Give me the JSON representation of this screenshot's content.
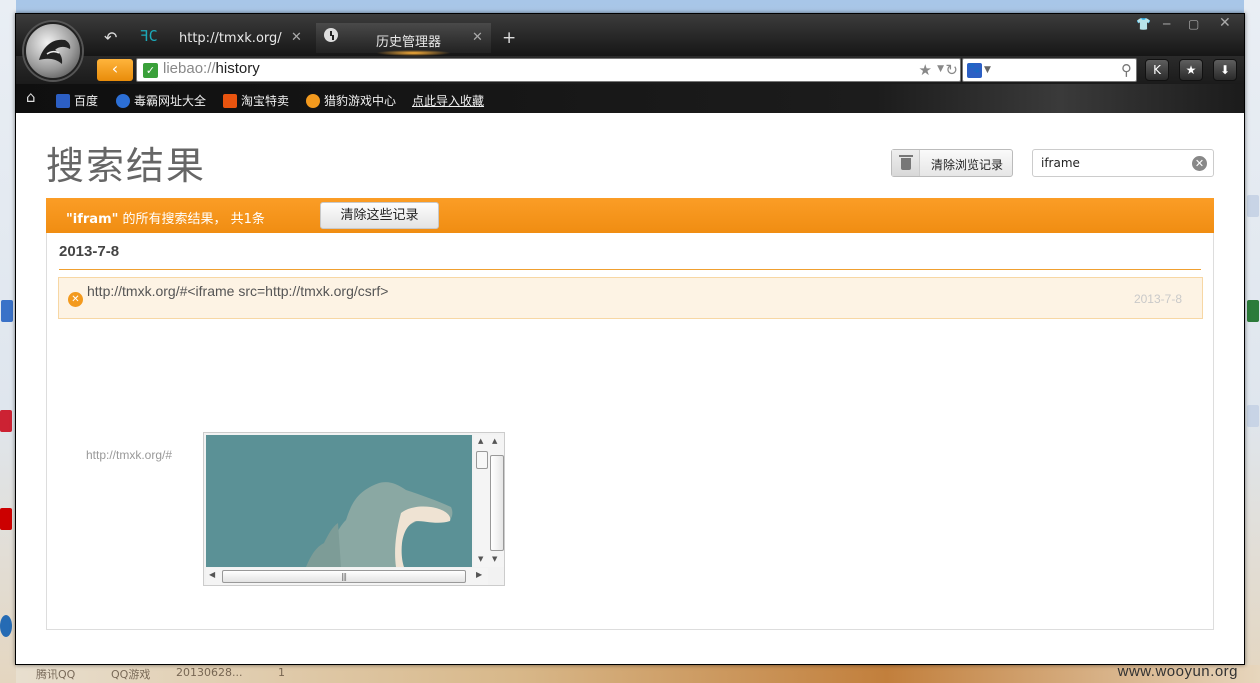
{
  "desktop": {
    "taskbar_items": [
      "腾讯QQ",
      "QQ游戏",
      "20130628...",
      "1"
    ],
    "watermark": "www.wooyun.org"
  },
  "browser": {
    "tabs": [
      {
        "title": "http://tmxk.org/",
        "active": false
      },
      {
        "title": "历史管理器",
        "active": true
      }
    ],
    "address": {
      "scheme": "liebao://",
      "path": "history"
    },
    "search_value": "",
    "bookmarks": [
      {
        "label": "百度",
        "icon": "baidu-icon",
        "color": "#2c5fc4"
      },
      {
        "label": "毒霸网址大全",
        "icon": "duba-icon",
        "color": "#2c6fd6"
      },
      {
        "label": "淘宝特卖",
        "icon": "taobao-icon",
        "color": "#e9540f"
      },
      {
        "label": "猎豹游戏中心",
        "icon": "liebao-game-icon",
        "color": "#f39a1e"
      },
      {
        "label": "点此导入收藏",
        "icon": "",
        "color": ""
      }
    ]
  },
  "history": {
    "title": "搜索结果",
    "clear_all_label": "清除浏览记录",
    "search_value": "iframe",
    "summary_keyword": "\"ifram\"",
    "summary_text": " 的所有搜索结果， 共1条",
    "clear_these_label": "清除这些记录",
    "date": "2013-7-8",
    "entries": [
      {
        "url": "http://tmxk.org/#<iframe src=http://tmxk.org/csrf>",
        "time": "2013-7-8"
      }
    ],
    "faded_url": "http://tmxk.org/#"
  },
  "colors": {
    "accent": "#f39a1e",
    "dark_chrome": "#1c1c1c"
  }
}
